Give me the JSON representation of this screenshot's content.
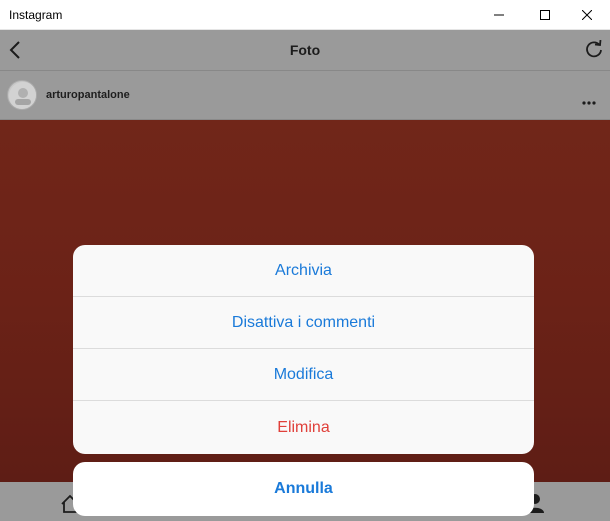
{
  "window": {
    "title": "Instagram",
    "controls": [
      "minimize-icon",
      "maximize-icon",
      "close-icon"
    ]
  },
  "header": {
    "title": "Foto",
    "back_icon": "chevron-left-icon",
    "refresh_icon": "refresh-icon"
  },
  "post": {
    "username": "arturopantalone",
    "more_icon": "more-horizontal-icon",
    "photo_color": "#6b2217"
  },
  "action_sheet": {
    "items": [
      {
        "label": "Archivia",
        "color": "#1a7ad9"
      },
      {
        "label": "Disattiva i commenti",
        "color": "#1a7ad9"
      },
      {
        "label": "Modifica",
        "color": "#1a7ad9"
      },
      {
        "label": "Elimina",
        "color": "#e0403a"
      }
    ],
    "cancel_label": "Annulla"
  },
  "bottom_nav": {
    "icons": [
      "home-icon",
      "profile-icon"
    ]
  }
}
